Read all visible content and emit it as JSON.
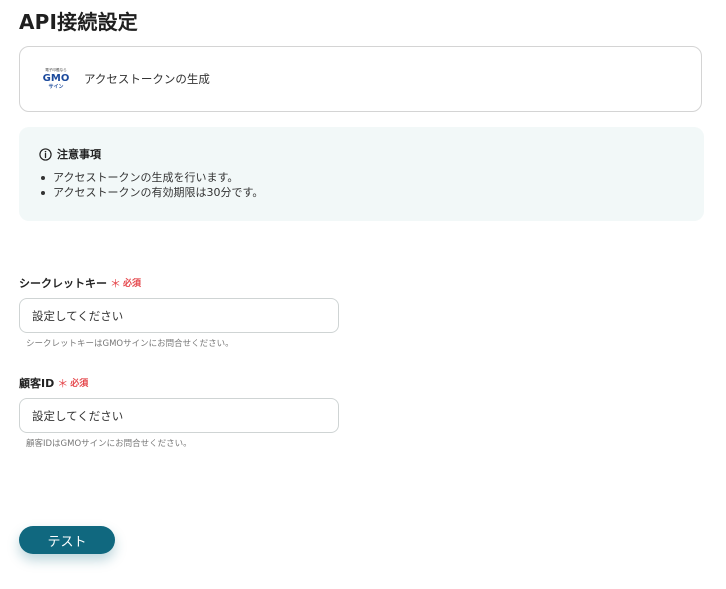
{
  "page": {
    "title": "API接続設定"
  },
  "action": {
    "logo": {
      "tagline": "電子印鑑なら",
      "brand": "GMO",
      "sub": "サイン",
      "icon": "gmo-sign-logo"
    },
    "label": "アクセストークンの生成"
  },
  "notice": {
    "icon": "info-circle-icon",
    "title": "注意事項",
    "items": [
      "アクセストークンの生成を行います。",
      "アクセストークンの有効期限は30分です。"
    ]
  },
  "fields": {
    "secret_key": {
      "label": "シークレットキー",
      "required_mark": "＊",
      "required_text": "必須",
      "placeholder": "設定してください",
      "value": "",
      "help": "シークレットキーはGMOサインにお問合せください。"
    },
    "customer_id": {
      "label": "顧客ID",
      "required_mark": "＊",
      "required_text": "必須",
      "placeholder": "設定してください",
      "value": "",
      "help": "顧客IDはGMOサインにお問合せください。"
    }
  },
  "buttons": {
    "test_label": "テスト"
  },
  "colors": {
    "primary": "#10687f",
    "required": "#e5484d",
    "notice_bg": "#f2f8f8",
    "border": "#d4d4d4"
  }
}
